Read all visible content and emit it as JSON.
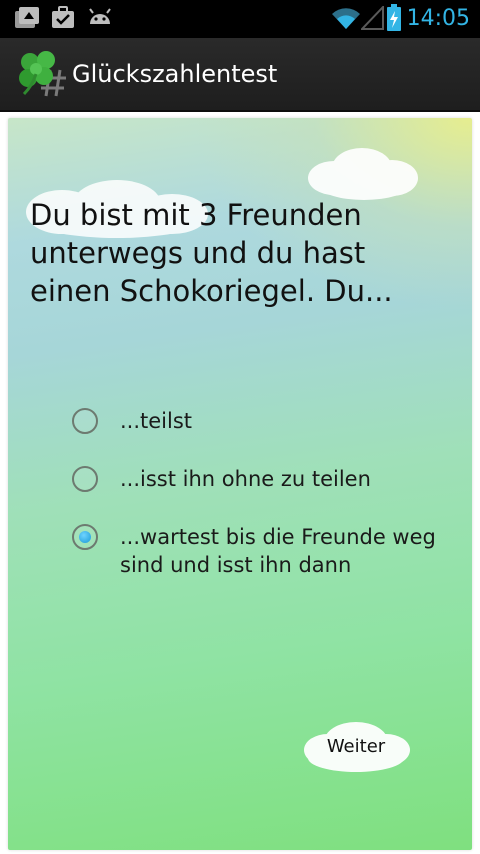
{
  "status_bar": {
    "time": "14:05",
    "icons": [
      "upload-icon",
      "briefcase-icon",
      "android-icon",
      "wifi-icon",
      "signal-icon",
      "battery-charging-icon"
    ],
    "accent_color": "#33b5e5"
  },
  "action_bar": {
    "title": "Glückszahlentest",
    "app_icon": "clover-icon"
  },
  "question": {
    "text": "Du bist mit 3 Freunden unterwegs und du hast einen Schokoriegel. Du..."
  },
  "options": [
    {
      "label": "...teilst",
      "checked": false
    },
    {
      "label": "...isst ihn ohne zu teilen",
      "checked": false
    },
    {
      "label": "...wartest bis die Freunde weg sind und isst ihn dann",
      "checked": true
    }
  ],
  "next_button": {
    "label": "Weiter"
  }
}
